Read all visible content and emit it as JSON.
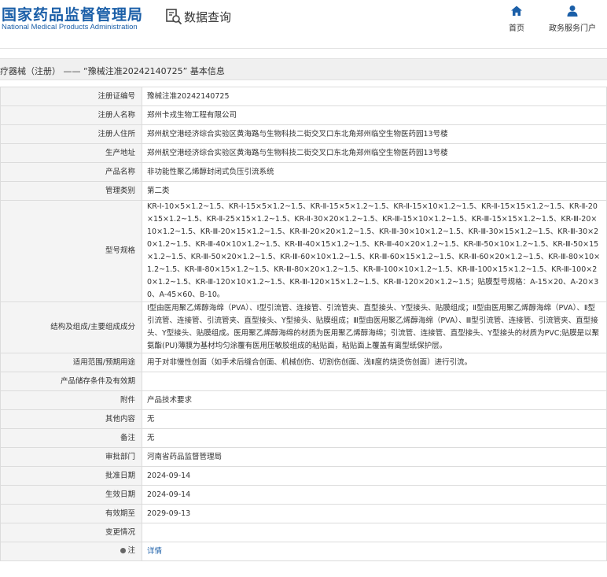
{
  "header": {
    "logo_cn": "国家药品监督管理局",
    "logo_en": "National Medical Products Administration",
    "query_label": "数据查询",
    "nav": [
      {
        "label": "首页",
        "icon": "home-icon"
      },
      {
        "label": "政务服务门户",
        "icon": "user-icon"
      }
    ]
  },
  "title": "疗器械（注册） —— “豫械注准20242140725” 基本信息",
  "colors": {
    "brand": "#1b5fa8",
    "label_bg": "#f4f4f4",
    "title_bg": "#f0f0f0"
  },
  "rows": [
    {
      "label": "注册证编号",
      "value": "豫械注准20242140725"
    },
    {
      "label": "注册人名称",
      "value": "郑州卡戎生物工程有限公司"
    },
    {
      "label": "注册人住所",
      "value": "郑州航空港经济综合实验区黄海路与生物科技二街交叉口东北角郑州临空生物医药园13号楼"
    },
    {
      "label": "生产地址",
      "value": "郑州航空港经济综合实验区黄海路与生物科技二街交叉口东北角郑州临空生物医药园13号楼"
    },
    {
      "label": "产品名称",
      "value": "非功能性聚乙烯醇封闭式负压引流系统"
    },
    {
      "label": "管理类别",
      "value": "第二类"
    },
    {
      "label": "型号规格",
      "value": "KR-Ⅰ-10×5×1.2~1.5、KR-Ⅰ-15×5×1.2~1.5、KR-Ⅱ-15×5×1.2~1.5、KR-Ⅱ-15×10×1.2~1.5、KR-Ⅱ-15×15×1.2~1.5、KR-Ⅱ-20×15×1.2~1.5、KR-Ⅱ-25×15×1.2~1.5、KR-Ⅱ-30×20×1.2~1.5、KR-Ⅲ-15×10×1.2~1.5、KR-Ⅲ-15×15×1.2~1.5、KR-Ⅲ-20×10×1.2~1.5、KR-Ⅲ-20×15×1.2~1.5、KR-Ⅲ-20×20×1.2~1.5、KR-Ⅲ-30×10×1.2~1.5、KR-Ⅲ-30×15×1.2~1.5、KR-Ⅲ-30×20×1.2~1.5、KR-Ⅲ-40×10×1.2~1.5、KR-Ⅲ-40×15×1.2~1.5、KR-Ⅲ-40×20×1.2~1.5、KR-Ⅲ-50×10×1.2~1.5、KR-Ⅲ-50×15×1.2~1.5、KR-Ⅲ-50×20×1.2~1.5、KR-Ⅲ-60×10×1.2~1.5、KR-Ⅲ-60×15×1.2~1.5、KR-Ⅲ-60×20×1.2~1.5、KR-Ⅲ-80×10×1.2~1.5、KR-Ⅲ-80×15×1.2~1.5、KR-Ⅲ-80×20×1.2~1.5、KR-Ⅲ-100×10×1.2~1.5、KR-Ⅲ-100×15×1.2~1.5、KR-Ⅲ-100×20×1.2~1.5、KR-Ⅲ-120×10×1.2~1.5、KR-Ⅲ-120×15×1.2~1.5、KR-Ⅲ-120×20×1.2~1.5；贴膜型号规格：A-15×20、A-20×30、A-45×60、B-10。"
    },
    {
      "label": "结构及组成/主要组成成分",
      "value": "Ⅰ型由医用聚乙烯醇海绵（PVA）、Ⅰ型引流管、连接管、引流管夹、直型接头、Y型接头、贴膜组成；Ⅱ型由医用聚乙烯醇海绵（PVA）、Ⅱ型引流管、连接管、引流管夹、直型接头、Y型接头、贴膜组成；Ⅲ型由医用聚乙烯醇海绵（PVA）、Ⅲ型引流管、连接管、引流管夹、直型接头、Y型接头、贴膜组成。医用聚乙烯醇海绵的材质为医用聚乙烯醇海绵；引流管、连接管、直型接头、Y型接头的材质为PVC;贴膜是以聚氨酯(PU)薄膜为基材均匀涂覆有医用压敏胶组成的粘贴面，粘贴面上覆盖有离型纸保护层。"
    },
    {
      "label": "适用范围/预期用途",
      "value": "用于对非慢性创面（如手术后缝合创面、机械创伤、切割伤创面、浅Ⅱ度的烧烫伤创面）进行引流。"
    },
    {
      "label": "产品储存条件及有效期",
      "value": ""
    },
    {
      "label": "附件",
      "value": "产品技术要求"
    },
    {
      "label": "其他内容",
      "value": "无"
    },
    {
      "label": "备注",
      "value": "无"
    },
    {
      "label": "审批部门",
      "value": "河南省药品监督管理局"
    },
    {
      "label": "批准日期",
      "value": "2024-09-14"
    },
    {
      "label": "生效日期",
      "value": "2024-09-14"
    },
    {
      "label": "有效期至",
      "value": "2029-09-13"
    },
    {
      "label": "变更情况",
      "value": ""
    }
  ],
  "note": {
    "label": "注",
    "value": "详情"
  }
}
